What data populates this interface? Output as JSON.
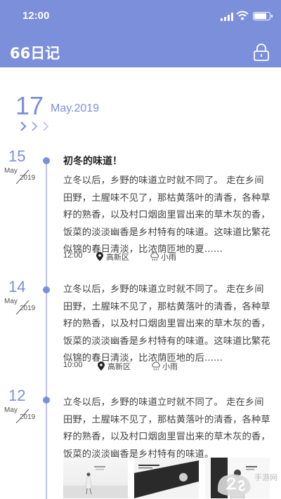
{
  "status_bar": {
    "time": "12:00",
    "battery_level": 0.85
  },
  "header": {
    "app_title": "66日记",
    "background_color": "#7c8fdb",
    "lock_icon": "lock-icon"
  },
  "current": {
    "day": "17",
    "month_year": "May.2019"
  },
  "entries": [
    {
      "day": "15",
      "month": "May",
      "year": "2019",
      "title": "初冬的味道！",
      "body": "立冬以后，乡野的味道立时就不同了。 走在乡间田野，土腥味不见了，那枯黄落叶的清香，各种草籽的熟香，以及村口烟囱里冒出来的草木灰的香，饭菜的淡淡幽香是乡村特有的味道。这味道比繁花似锦的春日清淡，比浓荫匝地的夏......",
      "time": "12:00",
      "location": "高新区",
      "weather": "小雨"
    },
    {
      "day": "14",
      "month": "May",
      "year": "2019",
      "body": "立冬以后，乡野的味道立时就不同了。 走在乡间田野，土腥味不见了，那枯黄落叶的清香，各种草籽的熟香，以及村口烟囱里冒出来的草木灰的香，饭菜的淡淡幽香是乡村特有的味道。这味道比繁花似锦的春日清淡，比浓荫匝地的后......",
      "time": "10:00",
      "location": "高新区",
      "weather": "小雨"
    },
    {
      "day": "12",
      "month": "May",
      "year": "2019",
      "body": "立冬以后，乡野的味道立时就不同了。 走在乡间田野，土腥味不见了，那枯黄落叶的清香，各种草籽的熟香，以及村口烟囱里冒出来的草木灰的香，饭菜的淡淡幽香是乡村特有的味道。"
    }
  ],
  "watermark": {
    "text": "手游网"
  }
}
